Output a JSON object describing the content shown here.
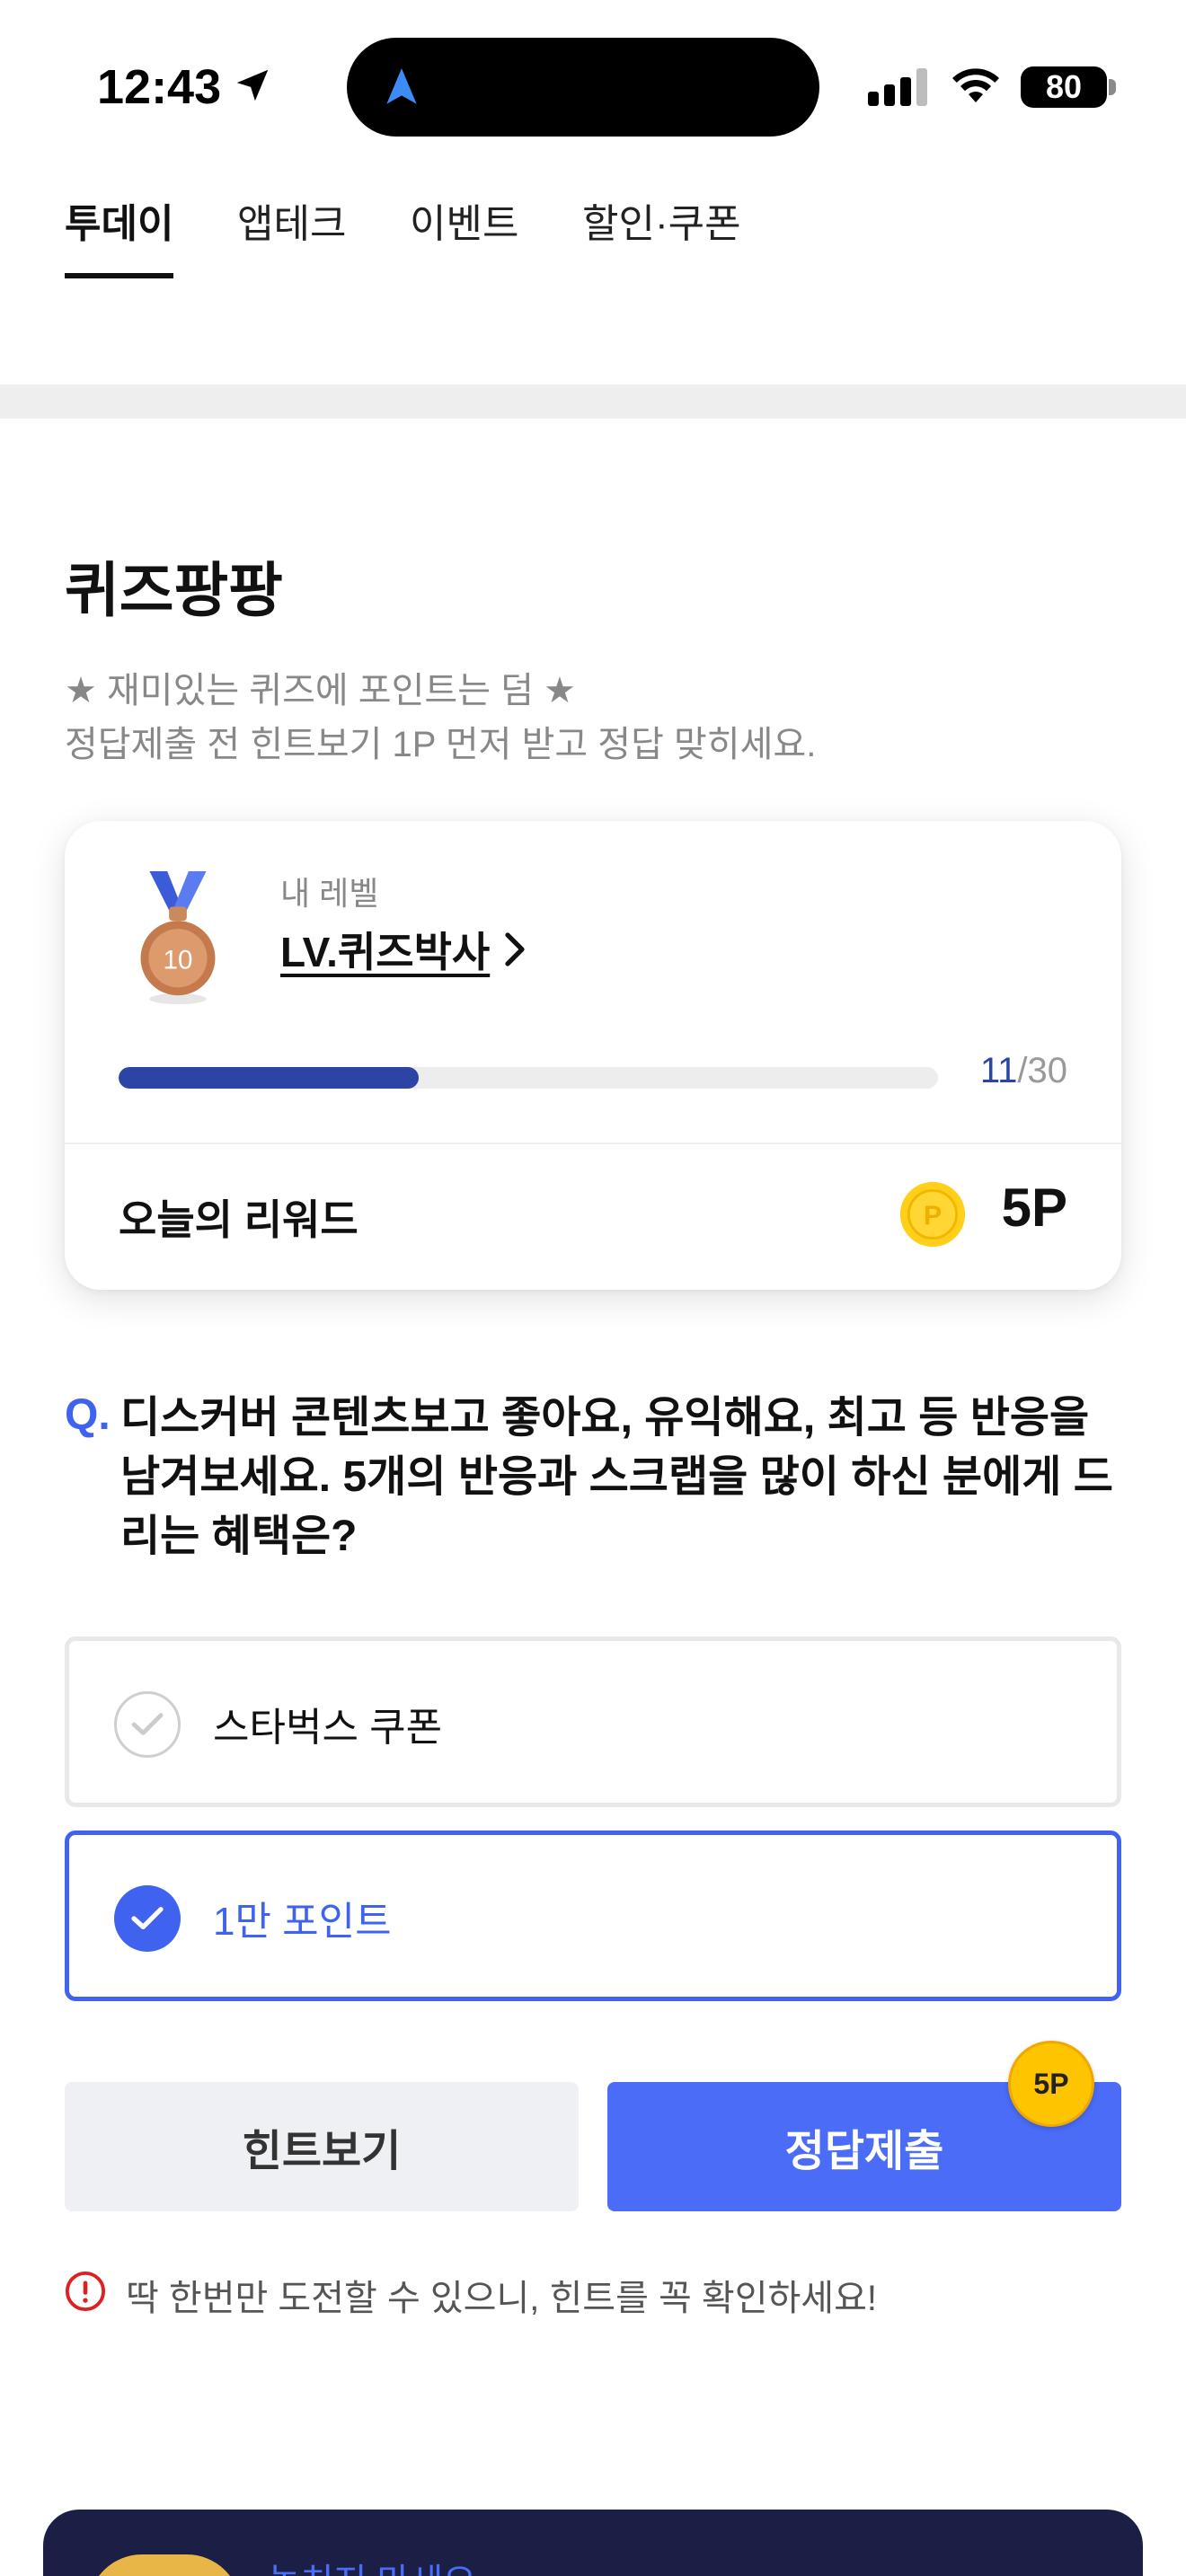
{
  "status_bar": {
    "time": "12:43",
    "battery": "80",
    "icons": [
      "location-arrow-icon",
      "navigation-icon",
      "cellular-signal-icon",
      "wifi-icon",
      "battery-icon"
    ]
  },
  "tabs": [
    {
      "label": "투데이",
      "active": true
    },
    {
      "label": "앱테크",
      "active": false
    },
    {
      "label": "이벤트",
      "active": false
    },
    {
      "label": "할인·쿠폰",
      "active": false
    }
  ],
  "page": {
    "title": "퀴즈팡팡",
    "subtitle_line1": "★ 재미있는 퀴즈에 포인트는 덤 ★",
    "subtitle_line2": "정답제출 전 힌트보기 1P 먼저 받고 정답 맞히세요."
  },
  "level_card": {
    "medal_number": "10",
    "caption": "내 레벨",
    "level_name": "LV.퀴즈박사",
    "progress_current": "11",
    "progress_separator": "/",
    "progress_total": "30",
    "progress_fraction": 0.3667,
    "reward_label": "오늘의 리워드",
    "coin_letter": "P",
    "reward_value": "5P"
  },
  "quiz": {
    "prefix": "Q.",
    "question": "디스커버 콘텐츠보고 좋아요, 유익해요, 최고 등 반응을 남겨보세요. 5개의 반응과 스크랩을 많이 하신 분에게 드리는 혜택은?",
    "options": [
      {
        "label": "스타벅스 쿠폰",
        "selected": false
      },
      {
        "label": "1만 포인트",
        "selected": true
      }
    ]
  },
  "buttons": {
    "hint": "힌트보기",
    "submit": "정답제출",
    "submit_badge": "5P"
  },
  "warning": "딱 한번만 도전할 수 있으니, 힌트를 꼭 확인하세요!",
  "banner": {
    "text": "놓치지 마세요"
  },
  "colors": {
    "accent": "#4a6cf7",
    "progress": "#2c44a4",
    "coin": "#ffc400",
    "warning": "#e02020",
    "banner_bg": "#1c1f45"
  }
}
